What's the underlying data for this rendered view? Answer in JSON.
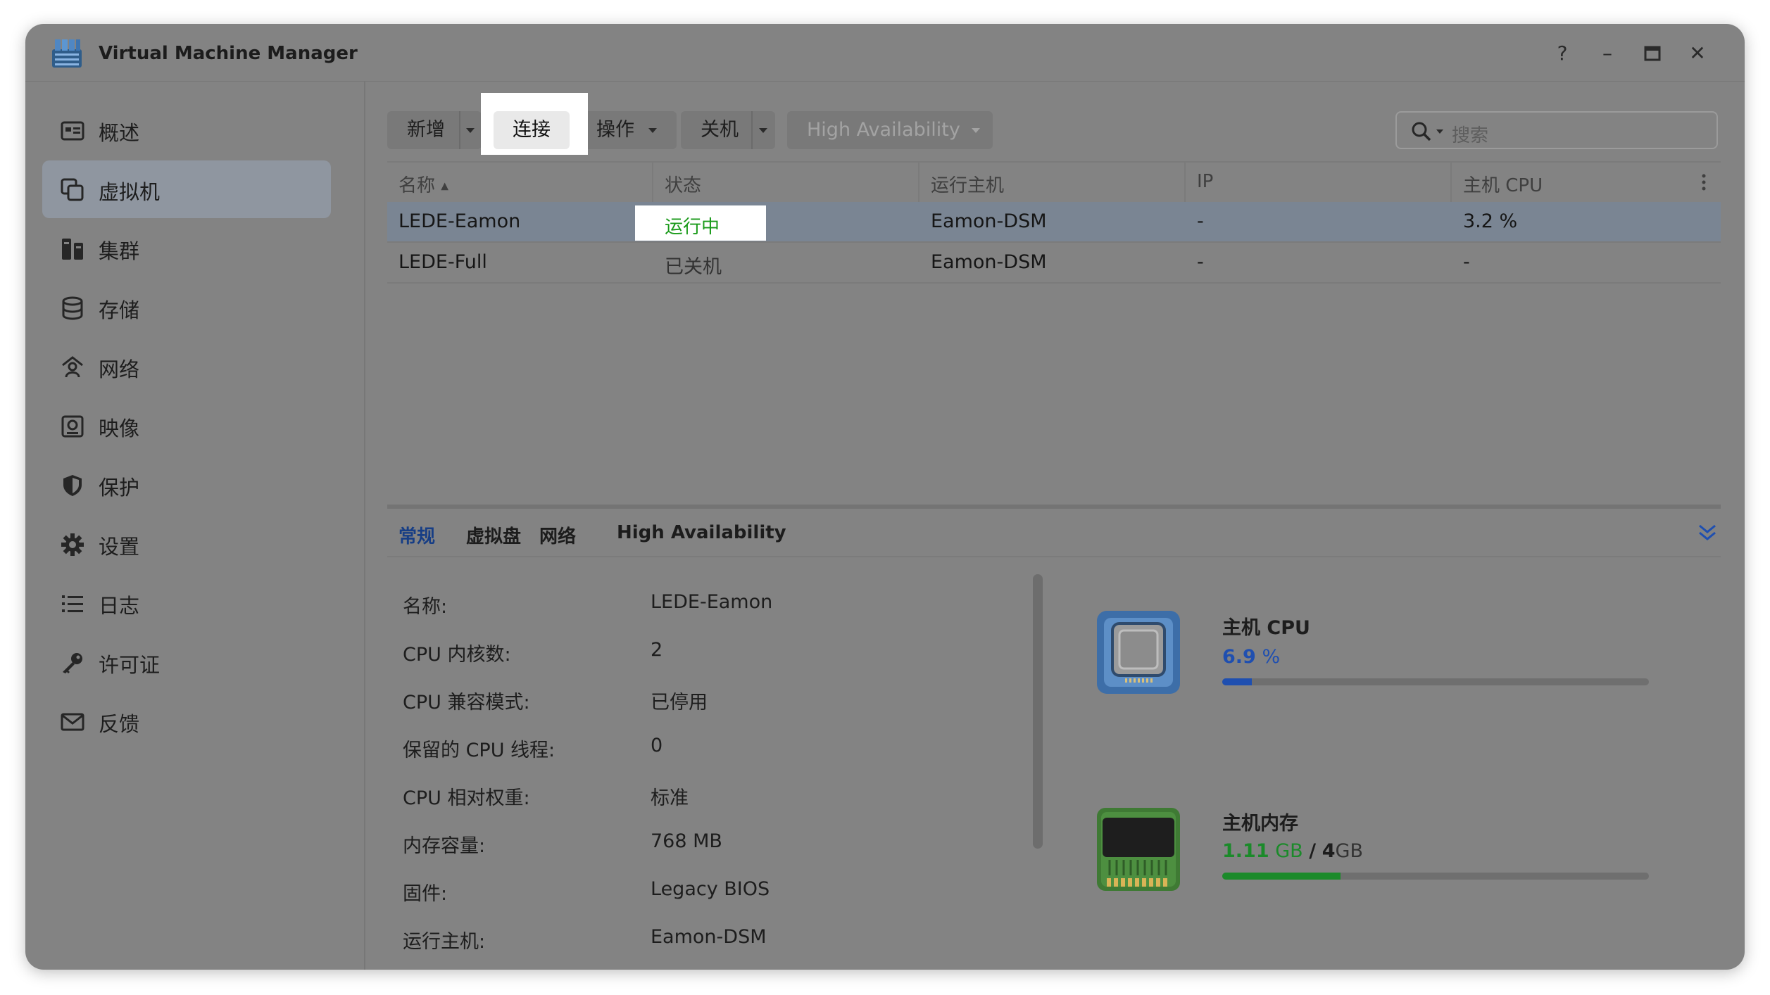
{
  "window": {
    "title": "Virtual Machine Manager",
    "controls": [
      "?",
      "–",
      "□",
      "✕"
    ]
  },
  "sidebar": {
    "items": [
      {
        "label": "概述",
        "icon": "overview-icon"
      },
      {
        "label": "虚拟机",
        "icon": "virtual-machine-icon",
        "active": true
      },
      {
        "label": "集群",
        "icon": "cluster-icon"
      },
      {
        "label": "存储",
        "icon": "storage-icon"
      },
      {
        "label": "网络",
        "icon": "network-icon"
      },
      {
        "label": "映像",
        "icon": "image-icon"
      },
      {
        "label": "保护",
        "icon": "shield-icon"
      },
      {
        "label": "设置",
        "icon": "gear-icon"
      },
      {
        "label": "日志",
        "icon": "log-list-icon"
      },
      {
        "label": "许可证",
        "icon": "key-icon"
      },
      {
        "label": "反馈",
        "icon": "mail-icon"
      }
    ]
  },
  "toolbar": {
    "create": "新增",
    "connect": "连接",
    "action": "操作",
    "shutdown": "关机",
    "high_availability": "High Availability",
    "search_placeholder": "搜索"
  },
  "table": {
    "columns": [
      "名称",
      "状态",
      "运行主机",
      "IP",
      "主机 CPU"
    ],
    "sort_indicator": "▲",
    "rows": [
      {
        "name": "LEDE-Eamon",
        "status": "运行中",
        "host": "Eamon-DSM",
        "ip": "-",
        "cpu": "3.2 %",
        "selected": true
      },
      {
        "name": "LEDE-Full",
        "status": "已关机",
        "host": "Eamon-DSM",
        "ip": "-",
        "cpu": "-",
        "selected": false
      }
    ]
  },
  "detail": {
    "tabs": [
      "常规",
      "虚拟盘",
      "网络",
      "High Availability"
    ],
    "active_tab": "常规",
    "properties": [
      {
        "label": "名称:",
        "value": "LEDE-Eamon"
      },
      {
        "label": "CPU 内核数:",
        "value": "2"
      },
      {
        "label": "CPU 兼容模式:",
        "value": "已停用"
      },
      {
        "label": "保留的 CPU 线程:",
        "value": "0"
      },
      {
        "label": "CPU 相对权重:",
        "value": "标准"
      },
      {
        "label": "内存容量:",
        "value": "768 MB"
      },
      {
        "label": "固件:",
        "value": "Legacy BIOS"
      },
      {
        "label": "运行主机:",
        "value": "Eamon-DSM"
      }
    ],
    "resources": {
      "cpu": {
        "title": "主机 CPU",
        "value": "6.9",
        "unit": "%",
        "fraction": 0.069,
        "color": "#1f4fb0"
      },
      "memory": {
        "title": "主机内存",
        "used": "1.11",
        "used_unit": "GB",
        "separator": "/",
        "total": "4",
        "total_unit": "GB",
        "fraction": 0.2775,
        "color": "#1b8a2a"
      }
    }
  }
}
